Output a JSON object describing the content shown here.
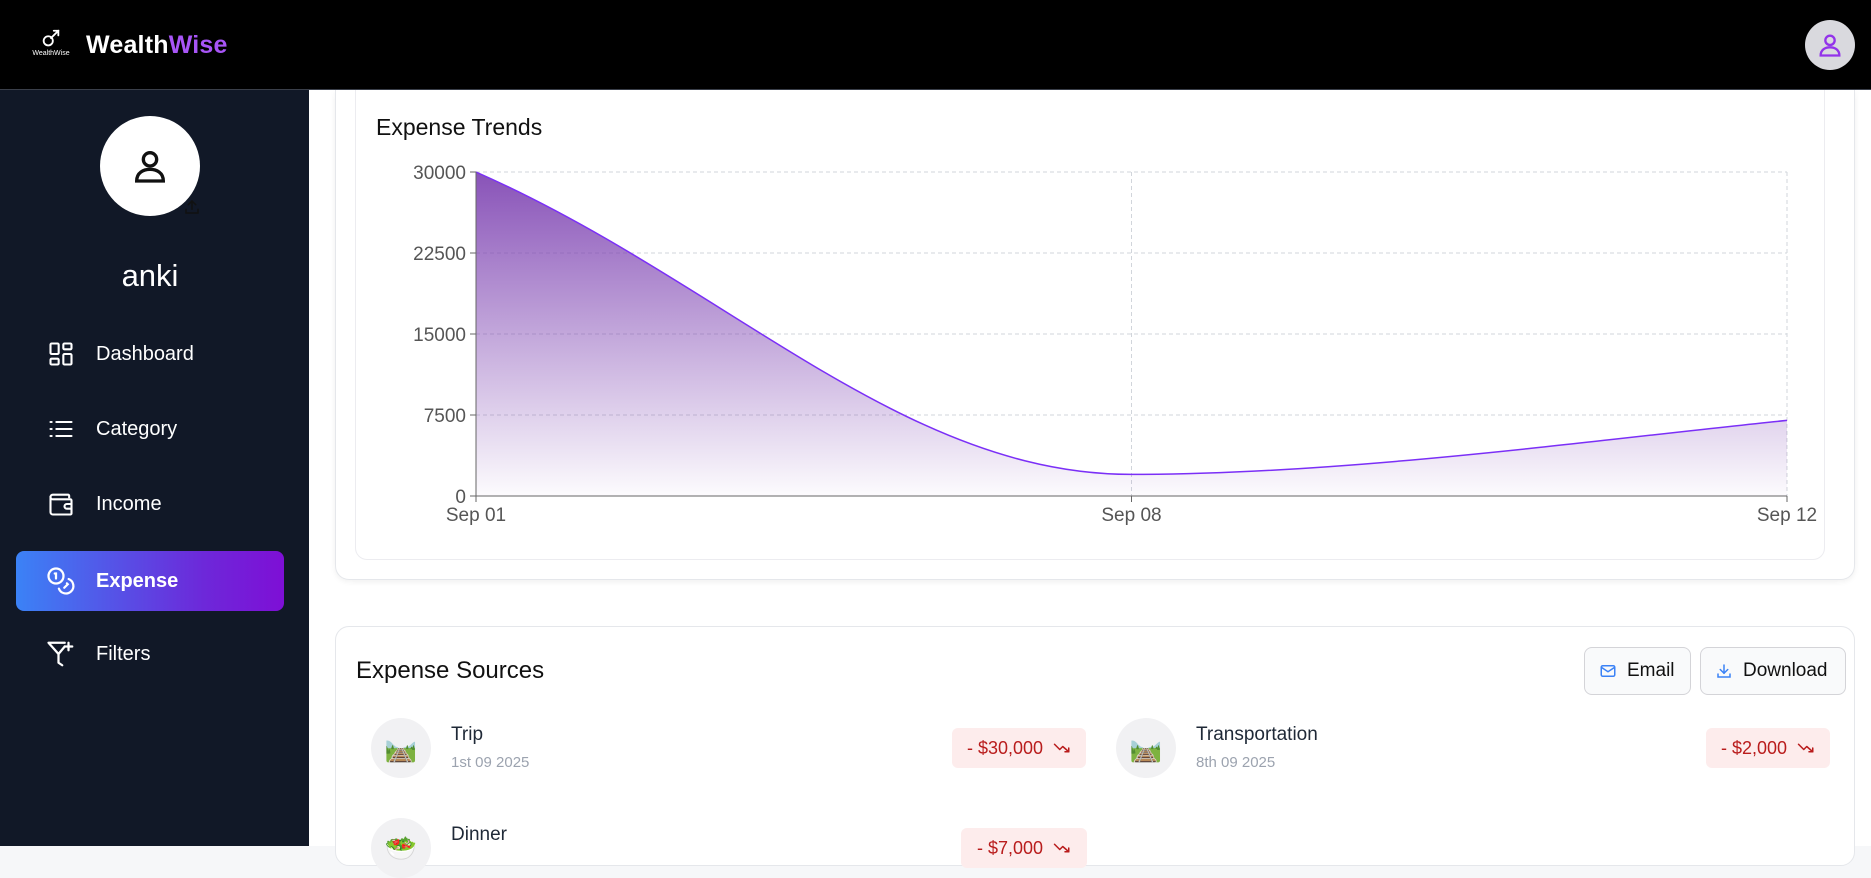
{
  "app": {
    "logo_small_text": "WealthWise",
    "brand_part1": "Wealth",
    "brand_part2": "Wise",
    "colors": {
      "brand_accent": "#a855f7",
      "header_bg": "#000000",
      "sidebar_bg": "#111827"
    }
  },
  "header": {
    "avatar_icon": "user-icon"
  },
  "sidebar": {
    "username": "anki",
    "avatar_icon": "user-icon",
    "upload_icon": "upload-icon",
    "items": [
      {
        "label": "Dashboard",
        "icon": "dashboard-grid-icon",
        "active": false
      },
      {
        "label": "Category",
        "icon": "list-icon",
        "active": false
      },
      {
        "label": "Income",
        "icon": "wallet-icon",
        "active": false
      },
      {
        "label": "Expense",
        "icon": "coins-icon",
        "active": true
      },
      {
        "label": "Filters",
        "icon": "filter-plus-icon",
        "active": false
      }
    ]
  },
  "chart": {
    "title": "Expense Trends"
  },
  "chart_data": {
    "type": "area",
    "title": "Expense Trends",
    "x": [
      "Sep 01",
      "Sep 08",
      "Sep 12"
    ],
    "series": [
      {
        "values": [
          30000,
          2000,
          7000
        ]
      }
    ],
    "y_ticks": [
      0,
      7500,
      15000,
      22500,
      30000
    ],
    "ylim": [
      0,
      30000
    ],
    "grid": true,
    "colors": {
      "line": "#7b2ff7",
      "fill_top": "#7b3fb0"
    }
  },
  "sources": {
    "title": "Expense Sources",
    "email_label": "Email",
    "download_label": "Download",
    "items": [
      {
        "name": "Trip",
        "date": "1st 09 2025",
        "amount": "- $30,000",
        "icon": "🛤️"
      },
      {
        "name": "Transportation",
        "date": "8th 09 2025",
        "amount": "- $2,000",
        "icon": "🛤️"
      },
      {
        "name": "Dinner",
        "date": "",
        "amount": "- $7,000",
        "icon": "🥗"
      }
    ]
  }
}
